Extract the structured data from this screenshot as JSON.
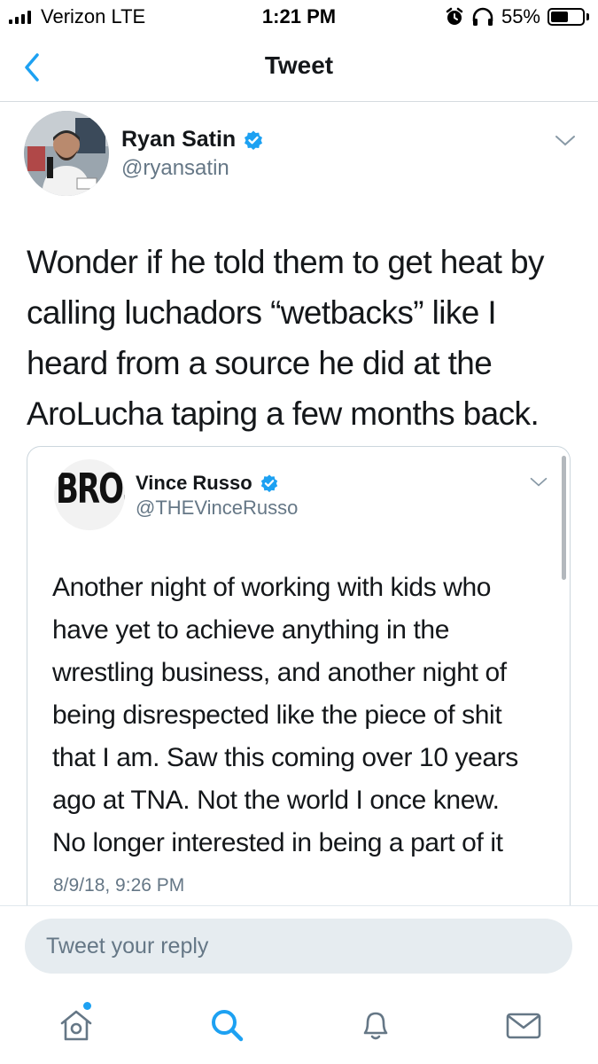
{
  "status_bar": {
    "carrier": "Verizon  LTE",
    "time": "1:21 PM",
    "battery_percent": "55%",
    "battery_level": 0.55,
    "icons": [
      "signal-bars-icon",
      "alarm-icon",
      "headphones-icon",
      "battery-icon"
    ]
  },
  "nav": {
    "title": "Tweet",
    "back_icon": "chevron-left-icon"
  },
  "tweet": {
    "author_name": "Ryan Satin",
    "author_handle": "@ryansatin",
    "verified": true,
    "text_lines": [
      "Wonder if he told them to get heat by",
      "calling luchadors “wetbacks” like I",
      "heard from a source he did at the",
      "AroLucha taping a few months back."
    ],
    "menu_icon": "chevron-down-icon"
  },
  "quoted_tweet": {
    "logo_text": "BRO.",
    "author_name": "Vince Russo",
    "author_handle": "@THEVinceRusso",
    "verified": true,
    "text_lines": [
      "Another night of working with kids who",
      "have yet to achieve anything in the",
      "wrestling business, and another night of",
      "being disrespected like the piece of shit",
      "that I am. Saw this coming over 10 years",
      "ago at TNA. Not the world I once knew.",
      "No longer interested in being a part of it"
    ],
    "timestamp": "8/9/18, 9:26 PM"
  },
  "reply": {
    "placeholder": "Tweet your reply"
  },
  "tab_bar": {
    "items": [
      "home-icon",
      "search-icon",
      "notifications-icon",
      "messages-icon"
    ],
    "active": "search-icon"
  },
  "colors": {
    "accent": "#1da1f2",
    "text_primary": "#14171a",
    "text_secondary": "#657786",
    "border": "#ccd6dd",
    "reply_bg": "#e6ecf0"
  }
}
